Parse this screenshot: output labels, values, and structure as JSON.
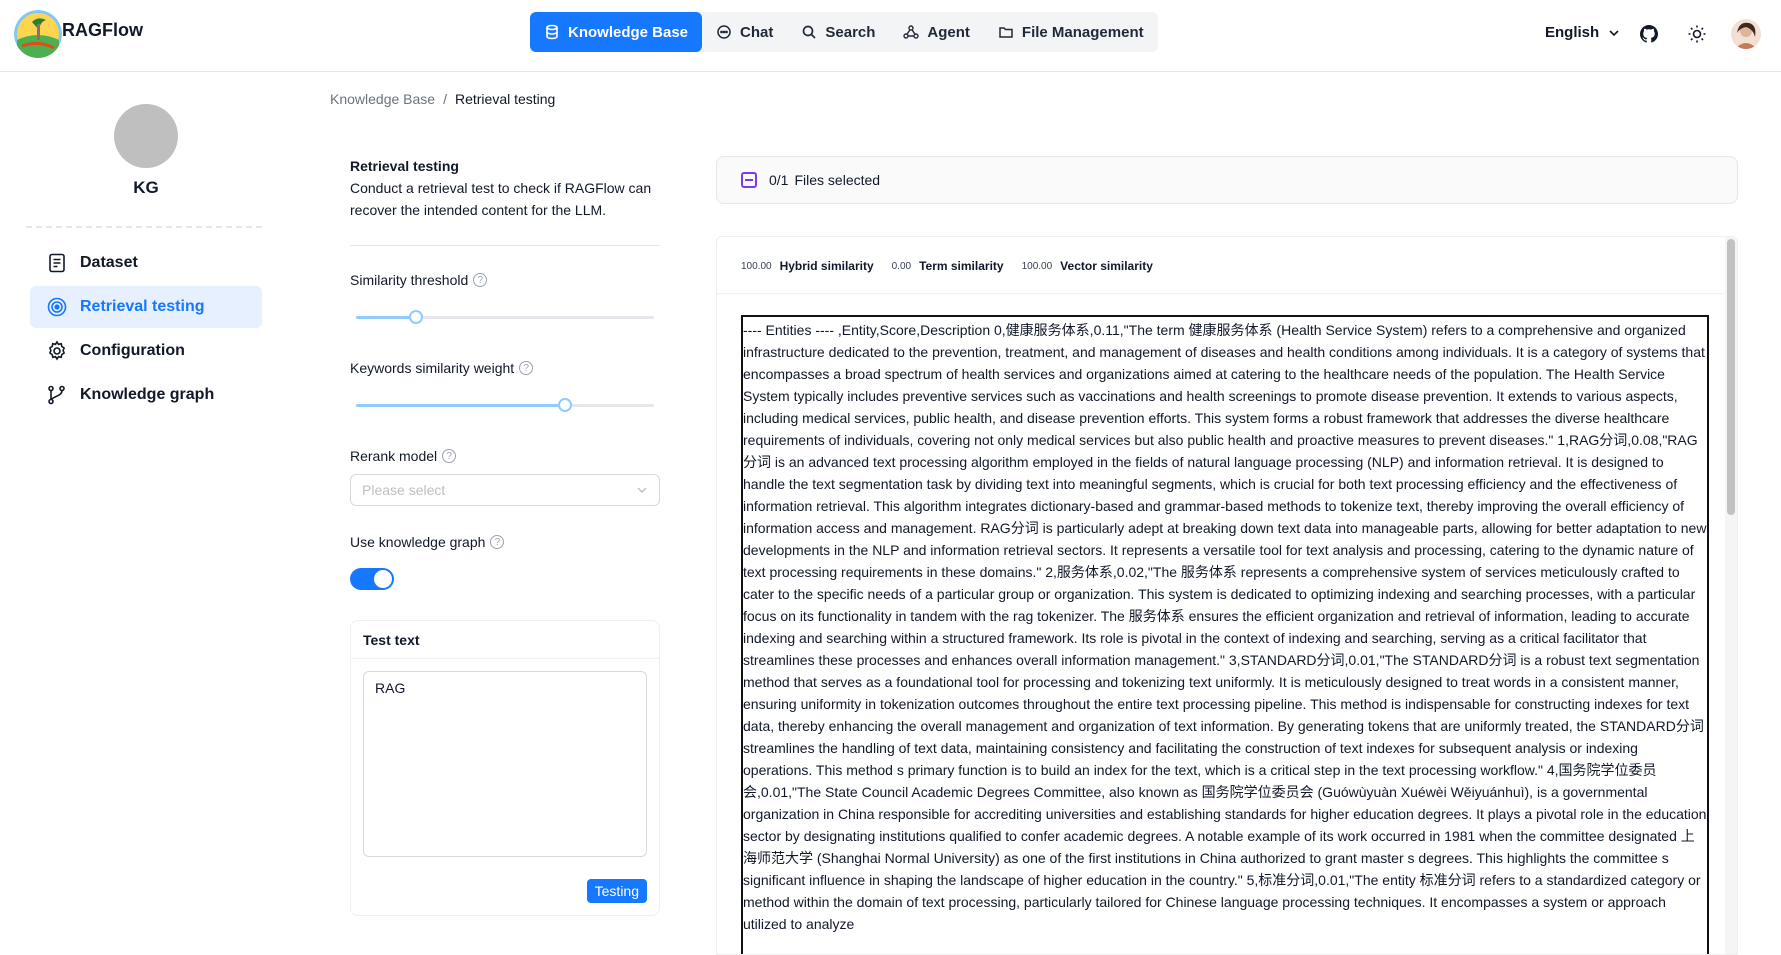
{
  "brand": {
    "name": "RAGFlow"
  },
  "nav": {
    "items": [
      {
        "label": "Knowledge Base",
        "icon": "database-icon",
        "active": true
      },
      {
        "label": "Chat",
        "icon": "chat-icon",
        "active": false
      },
      {
        "label": "Search",
        "icon": "search-icon",
        "active": false
      },
      {
        "label": "Agent",
        "icon": "agent-icon",
        "active": false
      },
      {
        "label": "File Management",
        "icon": "folder-icon",
        "active": false
      }
    ]
  },
  "header": {
    "language": "English"
  },
  "sidebar": {
    "kb_name": "KG",
    "items": [
      {
        "label": "Dataset",
        "icon": "document-icon",
        "active": false
      },
      {
        "label": "Retrieval testing",
        "icon": "target-icon",
        "active": true
      },
      {
        "label": "Configuration",
        "icon": "gear-icon",
        "active": false
      },
      {
        "label": "Knowledge graph",
        "icon": "graph-icon",
        "active": false
      }
    ]
  },
  "breadcrumb": {
    "parent": "Knowledge Base",
    "separator": "/",
    "current": "Retrieval testing"
  },
  "settings": {
    "title": "Retrieval testing",
    "description": "Conduct a retrieval test to check if RAGFlow can recover the intended content for the LLM.",
    "similarity_threshold": {
      "label": "Similarity threshold",
      "value": 0.2
    },
    "keywords_weight": {
      "label": "Keywords similarity weight",
      "value": 0.7
    },
    "rerank": {
      "label": "Rerank model",
      "placeholder": "Please select"
    },
    "knowledge_graph": {
      "label": "Use knowledge graph",
      "enabled": true
    },
    "test": {
      "title": "Test text",
      "value": "RAG",
      "button": "Testing"
    }
  },
  "results": {
    "files_selected": "0/1",
    "files_label": "Files selected",
    "hybrid": {
      "value": "100.00",
      "label": "Hybrid similarity"
    },
    "term": {
      "value": "0.00",
      "label": "Term similarity"
    },
    "vector": {
      "value": "100.00",
      "label": "Vector similarity"
    },
    "chunk_text": "---- Entities ---- ,Entity,Score,Description 0,健康服务体系,0.11,\"The term 健康服务体系 (Health Service System) refers to a comprehensive and organized infrastructure dedicated to the prevention, treatment, and management of diseases and health conditions among individuals. It is a category of systems that encompasses a broad spectrum of health services and organizations aimed at catering to the healthcare needs of the population. The Health Service System typically includes preventive services such as vaccinations and health screenings to promote disease prevention. It extends to various aspects, including medical services, public health, and disease prevention efforts. This system forms a robust framework that addresses the diverse healthcare requirements of individuals, covering not only medical services but also public health and proactive measures to prevent diseases.\" 1,RAG分词,0.08,\"RAG分词 is an advanced text processing algorithm employed in the fields of natural language processing (NLP) and information retrieval. It is designed to handle the text segmentation task by dividing text into meaningful segments, which is crucial for both text processing efficiency and the effectiveness of information retrieval. This algorithm integrates dictionary-based and grammar-based methods to tokenize text, thereby improving the overall efficiency of information access and management. RAG分词 is particularly adept at breaking down text data into manageable parts, allowing for better adaptation to new developments in the NLP and information retrieval sectors. It represents a versatile tool for text analysis and processing, catering to the dynamic nature of text processing requirements in these domains.\" 2,服务体系,0.02,\"The 服务体系 represents a comprehensive system of services meticulously crafted to cater to the specific needs of a particular group or organization. This system is dedicated to optimizing indexing and searching processes, with a particular focus on its functionality in tandem with the rag tokenizer. The 服务体系 ensures the efficient organization and retrieval of information, leading to accurate indexing and searching within a structured framework. Its role is pivotal in the context of indexing and searching, serving as a critical facilitator that streamlines these processes and enhances overall information management.\" 3,STANDARD分词,0.01,\"The STANDARD分词 is a robust text segmentation method that serves as a foundational tool for processing and tokenizing text uniformly. It is meticulously designed to treat words in a consistent manner, ensuring uniformity in tokenization outcomes throughout the entire text processing pipeline. This method is indispensable for constructing indexes for text data, thereby enhancing the overall management and organization of text information. By generating tokens that are uniformly treated, the STANDARD分词 streamlines the handling of text data, maintaining consistency and facilitating the construction of text indexes for subsequent analysis or indexing operations. This method s primary function is to build an index for the text, which is a critical step in the text processing workflow.\" 4,国务院学位委员会,0.01,\"The State Council Academic Degrees Committee, also known as 国务院学位委员会 (Guówùyuàn Xuéwèi Wěiyuánhuì), is a governmental organization in China responsible for accrediting universities and establishing standards for higher education degrees. It plays a pivotal role in the education sector by designating institutions qualified to confer academic degrees. A notable example of its work occurred in 1981 when the committee designated 上海师范大学 (Shanghai Normal University) as one of the first institutions in China authorized to grant master s degrees. This highlights the committee s significant influence in shaping the landscape of higher education in the country.\" 5,标准分词,0.01,\"The entity 标准分词 refers to a standardized category or method within the domain of text processing, particularly tailored for Chinese language processing techniques. It encompasses a system or approach utilized to analyze"
  },
  "colors": {
    "accent": "#1677ff",
    "accent_light": "#e6f0ff",
    "slider": "#91caff"
  }
}
